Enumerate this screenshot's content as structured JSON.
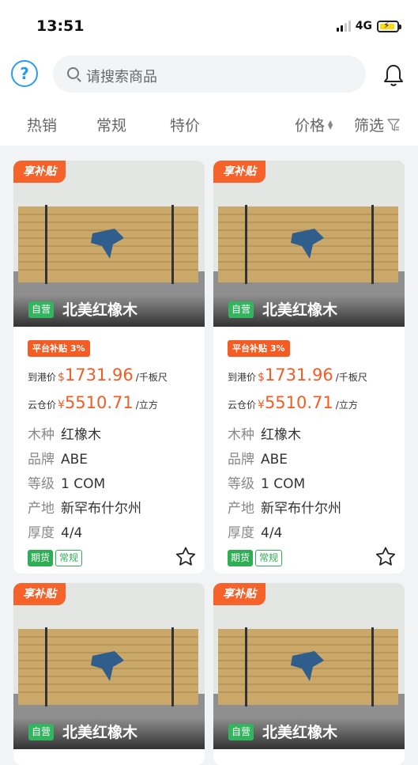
{
  "status_bar": {
    "time": "13:51",
    "network": "4G"
  },
  "search": {
    "placeholder": "请搜索商品"
  },
  "tabs": [
    {
      "label": "热销"
    },
    {
      "label": "常规"
    },
    {
      "label": "特价"
    },
    {
      "label": "价格"
    },
    {
      "label": "筛选"
    }
  ],
  "colors": {
    "accent_blue": "#2a9cf0",
    "price_orange": "#f45c24",
    "green": "#2fae56"
  },
  "products": [
    {
      "tag": "享补贴",
      "self_label": "自营",
      "title": "北美红橡木",
      "platform_subsidy": "平台补贴 3%",
      "port_price_label": "到港价",
      "port_price_currency": "$",
      "port_price": "1731.96",
      "port_price_unit": "/千板尺",
      "cloud_price_label": "云仓价",
      "cloud_price_currency": "¥",
      "cloud_price": "5510.71",
      "cloud_price_unit": "/立方",
      "attrs": [
        {
          "label": "木种",
          "value": "红橡木"
        },
        {
          "label": "品牌",
          "value": "ABE"
        },
        {
          "label": "等级",
          "value": "1 COM"
        },
        {
          "label": "产地",
          "value": "新罕布什尔州"
        },
        {
          "label": "厚度",
          "value": "4/4"
        }
      ],
      "tags": [
        "期货",
        "常规"
      ]
    },
    {
      "tag": "享补贴",
      "self_label": "自营",
      "title": "北美红橡木",
      "platform_subsidy": "平台补贴 3%",
      "port_price_label": "到港价",
      "port_price_currency": "$",
      "port_price": "1731.96",
      "port_price_unit": "/千板尺",
      "cloud_price_label": "云仓价",
      "cloud_price_currency": "¥",
      "cloud_price": "5510.71",
      "cloud_price_unit": "/立方",
      "attrs": [
        {
          "label": "木种",
          "value": "红橡木"
        },
        {
          "label": "品牌",
          "value": "ABE"
        },
        {
          "label": "等级",
          "value": "1 COM"
        },
        {
          "label": "产地",
          "value": "新罕布什尔州"
        },
        {
          "label": "厚度",
          "value": "4/4"
        }
      ],
      "tags": [
        "期货",
        "常规"
      ]
    },
    {
      "tag": "享补贴",
      "self_label": "自营",
      "title": "北美红橡木"
    },
    {
      "tag": "享补贴",
      "self_label": "自营",
      "title": "北美红橡木"
    }
  ]
}
